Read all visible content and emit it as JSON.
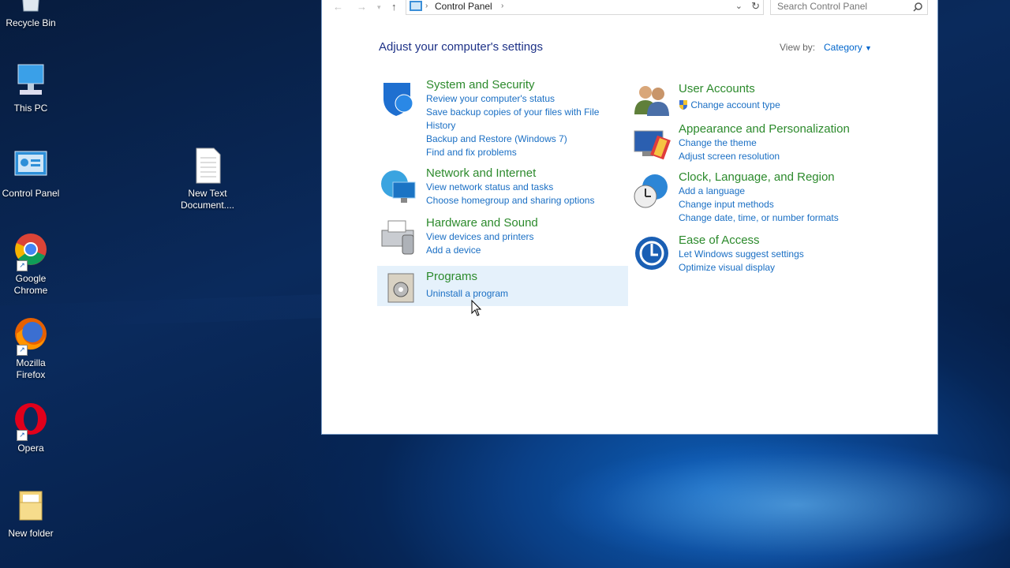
{
  "desktop": {
    "icons": [
      {
        "label": "Recycle Bin"
      },
      {
        "label": "This PC"
      },
      {
        "label": "Control Panel"
      },
      {
        "label": "New Text Document...."
      },
      {
        "label": "Google Chrome"
      },
      {
        "label": "Mozilla Firefox"
      },
      {
        "label": "Opera"
      },
      {
        "label": "New folder"
      }
    ]
  },
  "window": {
    "breadcrumb": "Control Panel",
    "search_placeholder": "Search Control Panel",
    "heading": "Adjust your computer's settings",
    "view_by_label": "View by:",
    "view_by_value": "Category",
    "categories": [
      {
        "title": "System and Security",
        "links": [
          "Review your computer's status",
          "Save backup copies of your files with File History",
          "Backup and Restore (Windows 7)",
          "Find and fix problems"
        ]
      },
      {
        "title": "Network and Internet",
        "links": [
          "View network status and tasks",
          "Choose homegroup and sharing options"
        ]
      },
      {
        "title": "Hardware and Sound",
        "links": [
          "View devices and printers",
          "Add a device"
        ]
      },
      {
        "title": "Programs",
        "links": [
          "Uninstall a program"
        ]
      },
      {
        "title": "User Accounts",
        "links": [
          "Change account type"
        ]
      },
      {
        "title": "Appearance and Personalization",
        "links": [
          "Change the theme",
          "Adjust screen resolution"
        ]
      },
      {
        "title": "Clock, Language, and Region",
        "links": [
          "Add a language",
          "Change input methods",
          "Change date, time, or number formats"
        ]
      },
      {
        "title": "Ease of Access",
        "links": [
          "Let Windows suggest settings",
          "Optimize visual display"
        ]
      }
    ]
  },
  "colors": {
    "category_title": "#2c8a2c",
    "link": "#1a6fc4",
    "heading": "#1e3287",
    "highlight": "#e5f1fb"
  }
}
